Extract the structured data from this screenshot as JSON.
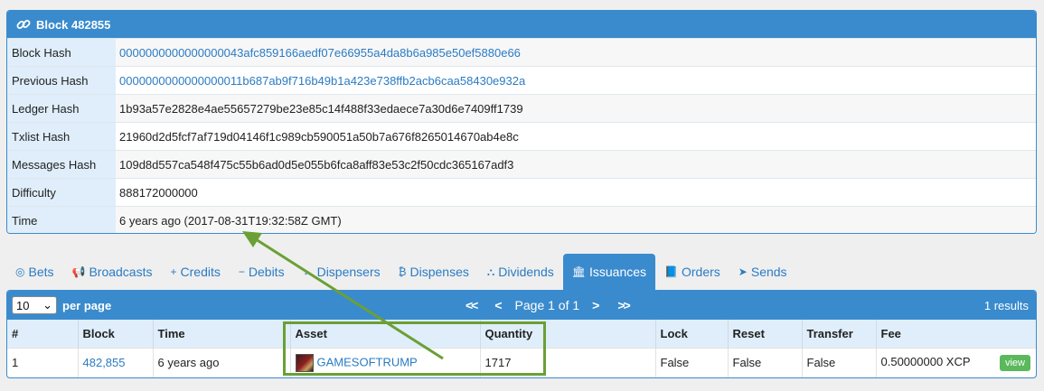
{
  "block": {
    "title": "Block 482855",
    "rows": [
      {
        "label": "Block Hash",
        "value": "0000000000000000043afc859166aedf07e66955a4da8b6a985e50ef5880e66",
        "link": true
      },
      {
        "label": "Previous Hash",
        "value": "0000000000000000011b687ab9f716b49b1a423e738ffb2acb6caa58430e932a",
        "link": true
      },
      {
        "label": "Ledger Hash",
        "value": "1b93a57e2828e4ae55657279be23e85c14f488f33edaece7a30d6e7409ff1739",
        "link": false
      },
      {
        "label": "Txlist Hash",
        "value": "21960d2d5fcf7af719d04146f1c989cb590051a50b7a676f8265014670ab4e8c",
        "link": false
      },
      {
        "label": "Messages Hash",
        "value": "109d8d557ca548f475c55b6ad0d5e055b6fca8aff83e53c2f50cdc365167adf3",
        "link": false
      },
      {
        "label": "Difficulty",
        "value": "888172000000",
        "link": false
      },
      {
        "label": "Time",
        "value": "6 years ago (2017-08-31T19:32:58Z GMT)",
        "link": false
      }
    ]
  },
  "tabs": [
    {
      "label": "Bets",
      "icon": "◎",
      "icon_name": "bullseye-icon"
    },
    {
      "label": "Broadcasts",
      "icon": "📢",
      "icon_name": "bullhorn-icon"
    },
    {
      "label": "Credits",
      "icon": "+",
      "icon_name": "plus-icon"
    },
    {
      "label": "Debits",
      "icon": "−",
      "icon_name": "minus-icon"
    },
    {
      "label": "Dispensers",
      "icon": "↔",
      "icon_name": "arrows-horizontal-icon"
    },
    {
      "label": "Dispenses",
      "icon": "₿",
      "icon_name": "bitcoin-icon"
    },
    {
      "label": "Dividends",
      "icon": "⛬",
      "icon_name": "sitemap-icon"
    },
    {
      "label": "Issuances",
      "icon": "🏛",
      "icon_name": "bank-icon",
      "active": true
    },
    {
      "label": "Orders",
      "icon": "📘",
      "icon_name": "book-icon"
    },
    {
      "label": "Sends",
      "icon": "➤",
      "icon_name": "send-icon"
    }
  ],
  "results": {
    "per_page_value": "10",
    "per_page_label": "per page",
    "first_label": "<<",
    "prev_label": "<",
    "page_label": "Page 1 of 1",
    "next_label": ">",
    "last_label": ">>",
    "count_label": "1 results",
    "columns": [
      "#",
      "Block",
      "Time",
      "Asset",
      "Quantity",
      "Lock",
      "Reset",
      "Transfer",
      "Fee"
    ],
    "rows": [
      {
        "num": "1",
        "block": "482,855",
        "time": "6 years ago",
        "asset": "GAMESOFTRUMP",
        "quantity": "1717",
        "lock": "False",
        "reset": "False",
        "transfer": "False",
        "fee": "0.50000000 XCP",
        "view_label": "view"
      }
    ]
  },
  "colors": {
    "header_blue": "#3a8bcd",
    "link_blue": "#2a7bc4",
    "annotation_green": "#6aa035",
    "view_button_green": "#5cb85c"
  }
}
